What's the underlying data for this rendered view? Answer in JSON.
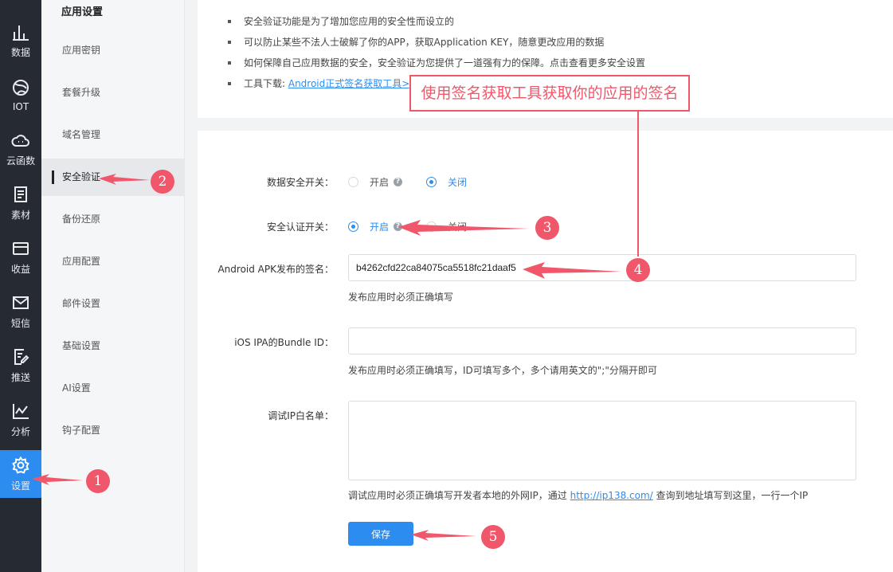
{
  "rail": {
    "items": [
      {
        "label": "数据",
        "icon": "bar-chart-icon"
      },
      {
        "label": "IOT",
        "icon": "globe-icon"
      },
      {
        "label": "云函数",
        "icon": "cloud-icon"
      },
      {
        "label": "素材",
        "icon": "document-icon"
      },
      {
        "label": "收益",
        "icon": "wallet-icon"
      },
      {
        "label": "短信",
        "icon": "mail-icon"
      },
      {
        "label": "推送",
        "icon": "edit-doc-icon"
      },
      {
        "label": "分析",
        "icon": "line-chart-icon"
      },
      {
        "label": "设置",
        "icon": "gear-icon"
      }
    ],
    "active": "设置"
  },
  "submenu": {
    "title": "应用设置",
    "items": [
      "应用密钥",
      "套餐升级",
      "域名管理",
      "安全验证",
      "备份还原",
      "应用配置",
      "邮件设置",
      "基础设置",
      "AI设置",
      "钩子配置"
    ],
    "active": "安全验证"
  },
  "notes": [
    "安全验证功能是为了增加您应用的安全性而设立的",
    "可以防止某些不法人士破解了你的APP，获取Application KEY，随意更改应用的数据",
    "如何保障自己应用数据的安全，安全验证为您提供了一道强有力的保障。点击查看更多安全设置"
  ],
  "tool_download": {
    "prefix": "工具下载: ",
    "link": "Android正式签名获取工具>>"
  },
  "form": {
    "data_security": {
      "label": "数据安全开关：",
      "on": "开启",
      "off": "关闭",
      "selected": "off"
    },
    "auth_switch": {
      "label": "安全认证开关：",
      "on": "开启",
      "off": "关闭",
      "selected": "on"
    },
    "android_sig": {
      "label": "Android APK发布的签名：",
      "value": "b4262cfd22ca84075ca5518fc21daaf5",
      "hint": "发布应用时必须正确填写"
    },
    "ios_bundle": {
      "label": "iOS IPA的Bundle ID：",
      "value": "",
      "hint": "发布应用时必须正确填写，ID可填写多个，多个请用英文的\";\"分隔开即可"
    },
    "debug_ip": {
      "label": "调试IP白名单：",
      "value": "",
      "hint_prefix": "调试应用时必须正确填写开发者本地的外网IP，通过 ",
      "hint_link": "http://ip138.com/",
      "hint_suffix": " 查询到地址填写到这里，一行一个IP"
    },
    "save_label": "保存"
  },
  "annotations": {
    "callout": "使用签名获取工具获取你的应用的签名",
    "numbers": [
      "1",
      "2",
      "3",
      "4",
      "5"
    ],
    "color": "#f0576a"
  },
  "colors": {
    "accent": "#2d8cf0",
    "rail_bg": "#262a33",
    "annotation": "#f0576a"
  }
}
